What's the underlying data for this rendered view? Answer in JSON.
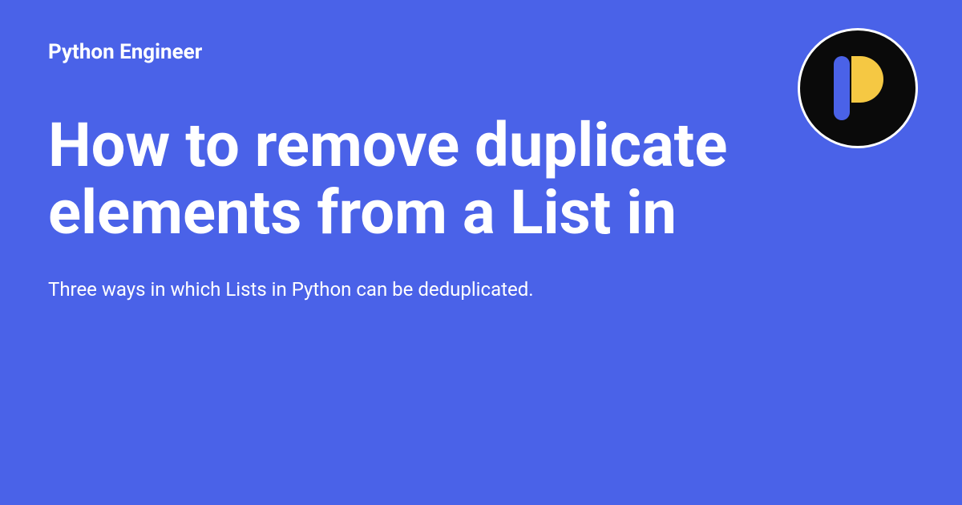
{
  "header": {
    "site_name": "Python Engineer"
  },
  "main": {
    "title": "How to remove duplicate elements from a List in",
    "subtitle": "Three ways in which Lists in Python can be deduplicated."
  }
}
